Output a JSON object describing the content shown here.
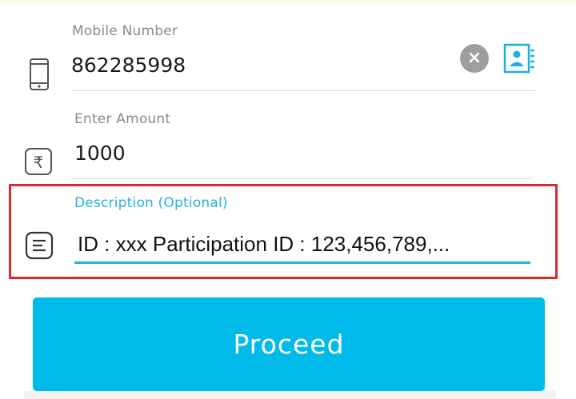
{
  "mobile": {
    "label": "Mobile Number",
    "value": "862285998",
    "clear_glyph": "×"
  },
  "amount": {
    "label": "Enter Amount",
    "value": "1000",
    "currency_symbol": "₹"
  },
  "description": {
    "label": "Description (Optional)",
    "value": "ID : xxx Participation ID : 123,456,789,..."
  },
  "proceed": {
    "label": "Proceed"
  },
  "colors": {
    "accent": "#00bbea",
    "label_active": "#23b3dc",
    "highlight_border": "#d92a32",
    "clear_button": "#9e9e9e"
  },
  "icons": {
    "mobile": "phone-icon",
    "amount": "rupee-icon",
    "description": "notes-icon",
    "contacts": "contact-book-icon",
    "clear": "clear-icon"
  }
}
